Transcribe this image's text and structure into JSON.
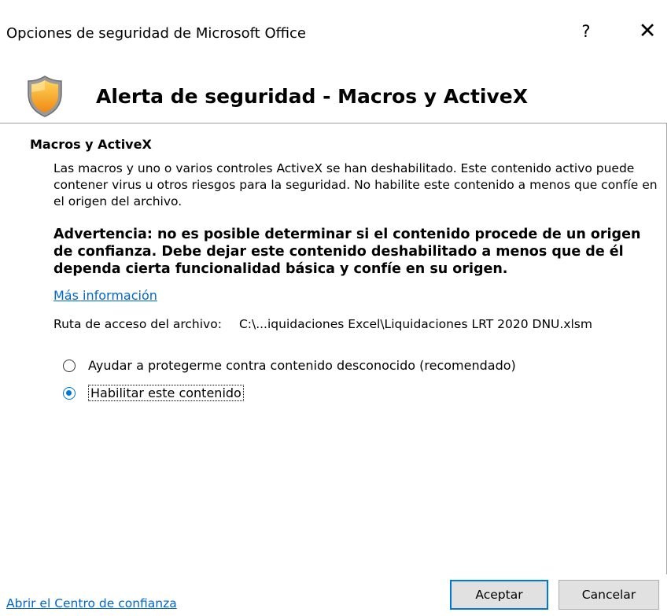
{
  "window": {
    "title": "Opciones de seguridad de Microsoft Office",
    "help_glyph": "?",
    "close_glyph": "✕"
  },
  "header": {
    "title": "Alerta de seguridad - Macros y ActiveX",
    "icon": "shield-icon"
  },
  "section": {
    "heading": "Macros y ActiveX",
    "description": "Las macros y uno o varios controles ActiveX se han deshabilitado. Este contenido activo puede contener virus u otros riesgos para la seguridad. No habilite este contenido a menos que confíe en el origen del archivo.",
    "warning": "Advertencia: no es posible determinar si el contenido procede de un origen de confianza. Debe dejar este contenido deshabilitado a menos que de él dependa cierta funcionalidad básica y confíe en su origen.",
    "more_info_link": "Más información",
    "path_label": "Ruta de acceso del archivo:",
    "path_value": "C:\\...iquidaciones Excel\\Liquidaciones LRT 2020 DNU.xlsm"
  },
  "options": [
    {
      "label": "Ayudar a protegerme contra contenido desconocido (recomendado)",
      "selected": false
    },
    {
      "label": "Habilitar este contenido",
      "selected": true
    }
  ],
  "footer": {
    "trust_center_link": "Abrir el Centro de confianza",
    "accept_label": "Aceptar",
    "cancel_label": "Cancelar"
  },
  "colors": {
    "accent": "#0078d7",
    "link": "#0066cc",
    "shield_orange": "#f39c1e"
  }
}
